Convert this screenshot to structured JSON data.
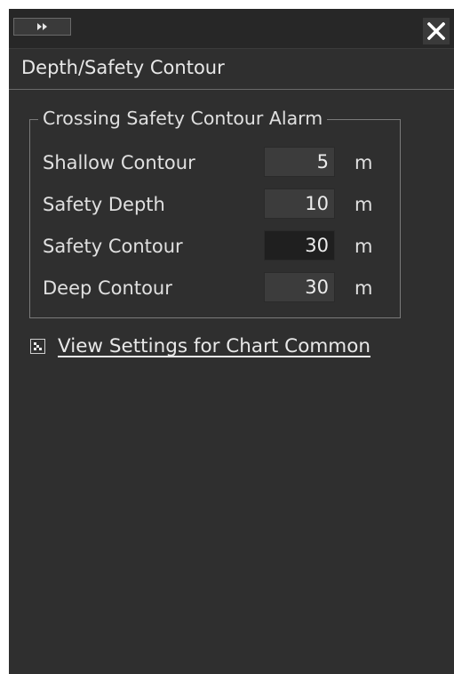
{
  "titlebar": {
    "expand_icon": "double-chevron-right-icon",
    "close_icon": "close-icon"
  },
  "header": {
    "title": "Depth/Safety Contour"
  },
  "alarm_group": {
    "legend": "Crossing Safety Contour Alarm",
    "rows": [
      {
        "label": "Shallow Contour",
        "value": "5",
        "unit": "m"
      },
      {
        "label": "Safety Depth",
        "value": "10",
        "unit": "m"
      },
      {
        "label": "Safety Contour",
        "value": "30",
        "unit": "m"
      },
      {
        "label": "Deep Contour",
        "value": "30",
        "unit": "m"
      }
    ]
  },
  "link": {
    "icon": "chart-settings-icon",
    "label": "View Settings for Chart Common"
  },
  "colors": {
    "panel_bg": "#2f2f2f",
    "text": "#e0e0e0",
    "input_bg": "#3c3c3c",
    "input_active_bg": "#1f1f1f"
  }
}
